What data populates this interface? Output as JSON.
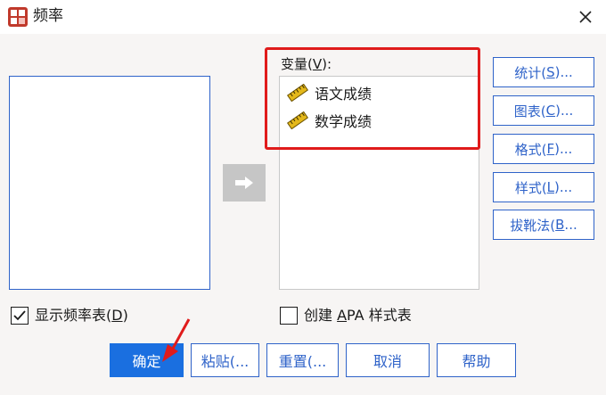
{
  "window": {
    "title": "频率",
    "close_icon": "close-icon"
  },
  "variables": {
    "label_prefix": "变量(",
    "label_key": "V",
    "label_suffix": "):",
    "items": [
      {
        "label": "语文成绩",
        "icon": "ruler-scale-icon"
      },
      {
        "label": "数学成绩",
        "icon": "ruler-scale-icon"
      }
    ]
  },
  "side_buttons": [
    {
      "pre": "统计(",
      "key": "S",
      "post": ")..."
    },
    {
      "pre": "图表(",
      "key": "C",
      "post": ")..."
    },
    {
      "pre": "格式(",
      "key": "F",
      "post": ")..."
    },
    {
      "pre": "样式(",
      "key": "L",
      "post": ")..."
    },
    {
      "pre": "拔靴法(",
      "key": "B",
      "post": "..."
    }
  ],
  "options": {
    "show_freq_pre": "显示频率表(",
    "show_freq_key": "D",
    "show_freq_post": ")",
    "show_freq_checked": true,
    "apa_pre": "创建 ",
    "apa_key": "A",
    "apa_post": "PA 样式表",
    "apa_checked": false
  },
  "bottom_buttons": {
    "ok": "确定",
    "paste": "粘贴(...",
    "reset": "重置(...",
    "cancel": "取消",
    "help": "帮助"
  },
  "colors": {
    "accent": "#2f63c9",
    "primary_button": "#1a6fe0",
    "highlight": "#e01b1b"
  }
}
